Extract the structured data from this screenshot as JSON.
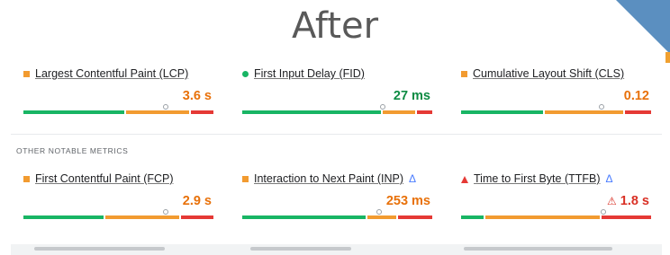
{
  "slide": {
    "title": "After"
  },
  "core_metrics": [
    {
      "label": "Largest Contentful Paint (LCP)",
      "value": "3.6 s",
      "status": "needs-improvement",
      "indicator": "square-orange-icon",
      "dist": [
        0.54,
        0.34,
        0.12
      ],
      "marker": 0.75
    },
    {
      "label": "First Input Delay (FID)",
      "value": "27 ms",
      "status": "good",
      "indicator": "circle-green-icon",
      "dist": [
        0.74,
        0.18,
        0.08
      ],
      "marker": 0.74
    },
    {
      "label": "Cumulative Layout Shift (CLS)",
      "value": "0.12",
      "status": "needs-improvement",
      "indicator": "square-orange-icon",
      "dist": [
        0.44,
        0.42,
        0.14
      ],
      "marker": 0.74
    }
  ],
  "other_heading": "OTHER NOTABLE METRICS",
  "other_metrics": [
    {
      "label": "First Contentful Paint (FCP)",
      "value": "2.9 s",
      "status": "needs-improvement",
      "indicator": "square-orange-icon",
      "experimental": false,
      "dist": [
        0.43,
        0.4,
        0.17
      ],
      "marker": 0.75
    },
    {
      "label": "Interaction to Next Paint (INP)",
      "value": "253 ms",
      "status": "needs-improvement",
      "indicator": "square-orange-icon",
      "experimental": true,
      "experimental_icon": "Δ",
      "dist": [
        0.66,
        0.16,
        0.18
      ],
      "marker": 0.72
    },
    {
      "label": "Time to First Byte (TTFB)",
      "value": "1.8 s",
      "status": "poor",
      "indicator": "triangle-red-icon",
      "experimental": true,
      "experimental_icon": "Δ",
      "warn_icon": "⚠",
      "dist": [
        0.13,
        0.61,
        0.26
      ],
      "marker": 0.75
    }
  ],
  "colors": {
    "good": "#18b564",
    "needs_improvement": "#f29b30",
    "poor": "#e53935",
    "accent": "#4a7cff",
    "deco": "#5b8fc0"
  }
}
